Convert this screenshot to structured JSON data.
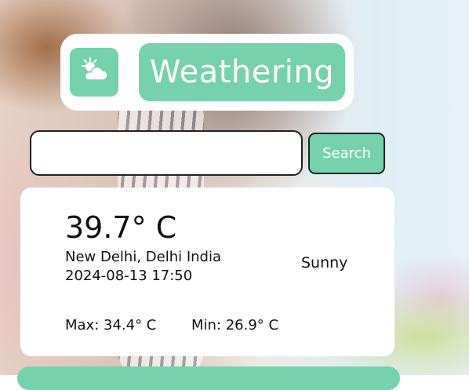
{
  "app": {
    "title": "Weathering",
    "logo_icon": "cloud-sun-icon",
    "accent_color": "#76d2ad"
  },
  "search": {
    "value": "",
    "placeholder": "",
    "button_label": "Search"
  },
  "weather": {
    "temperature": "39.7° C",
    "location": "New Delhi, Delhi India",
    "datetime": "2024-08-13 17:50",
    "condition": "Sunny",
    "max": "Max: 34.4° C",
    "min": "Min: 26.9° C"
  }
}
